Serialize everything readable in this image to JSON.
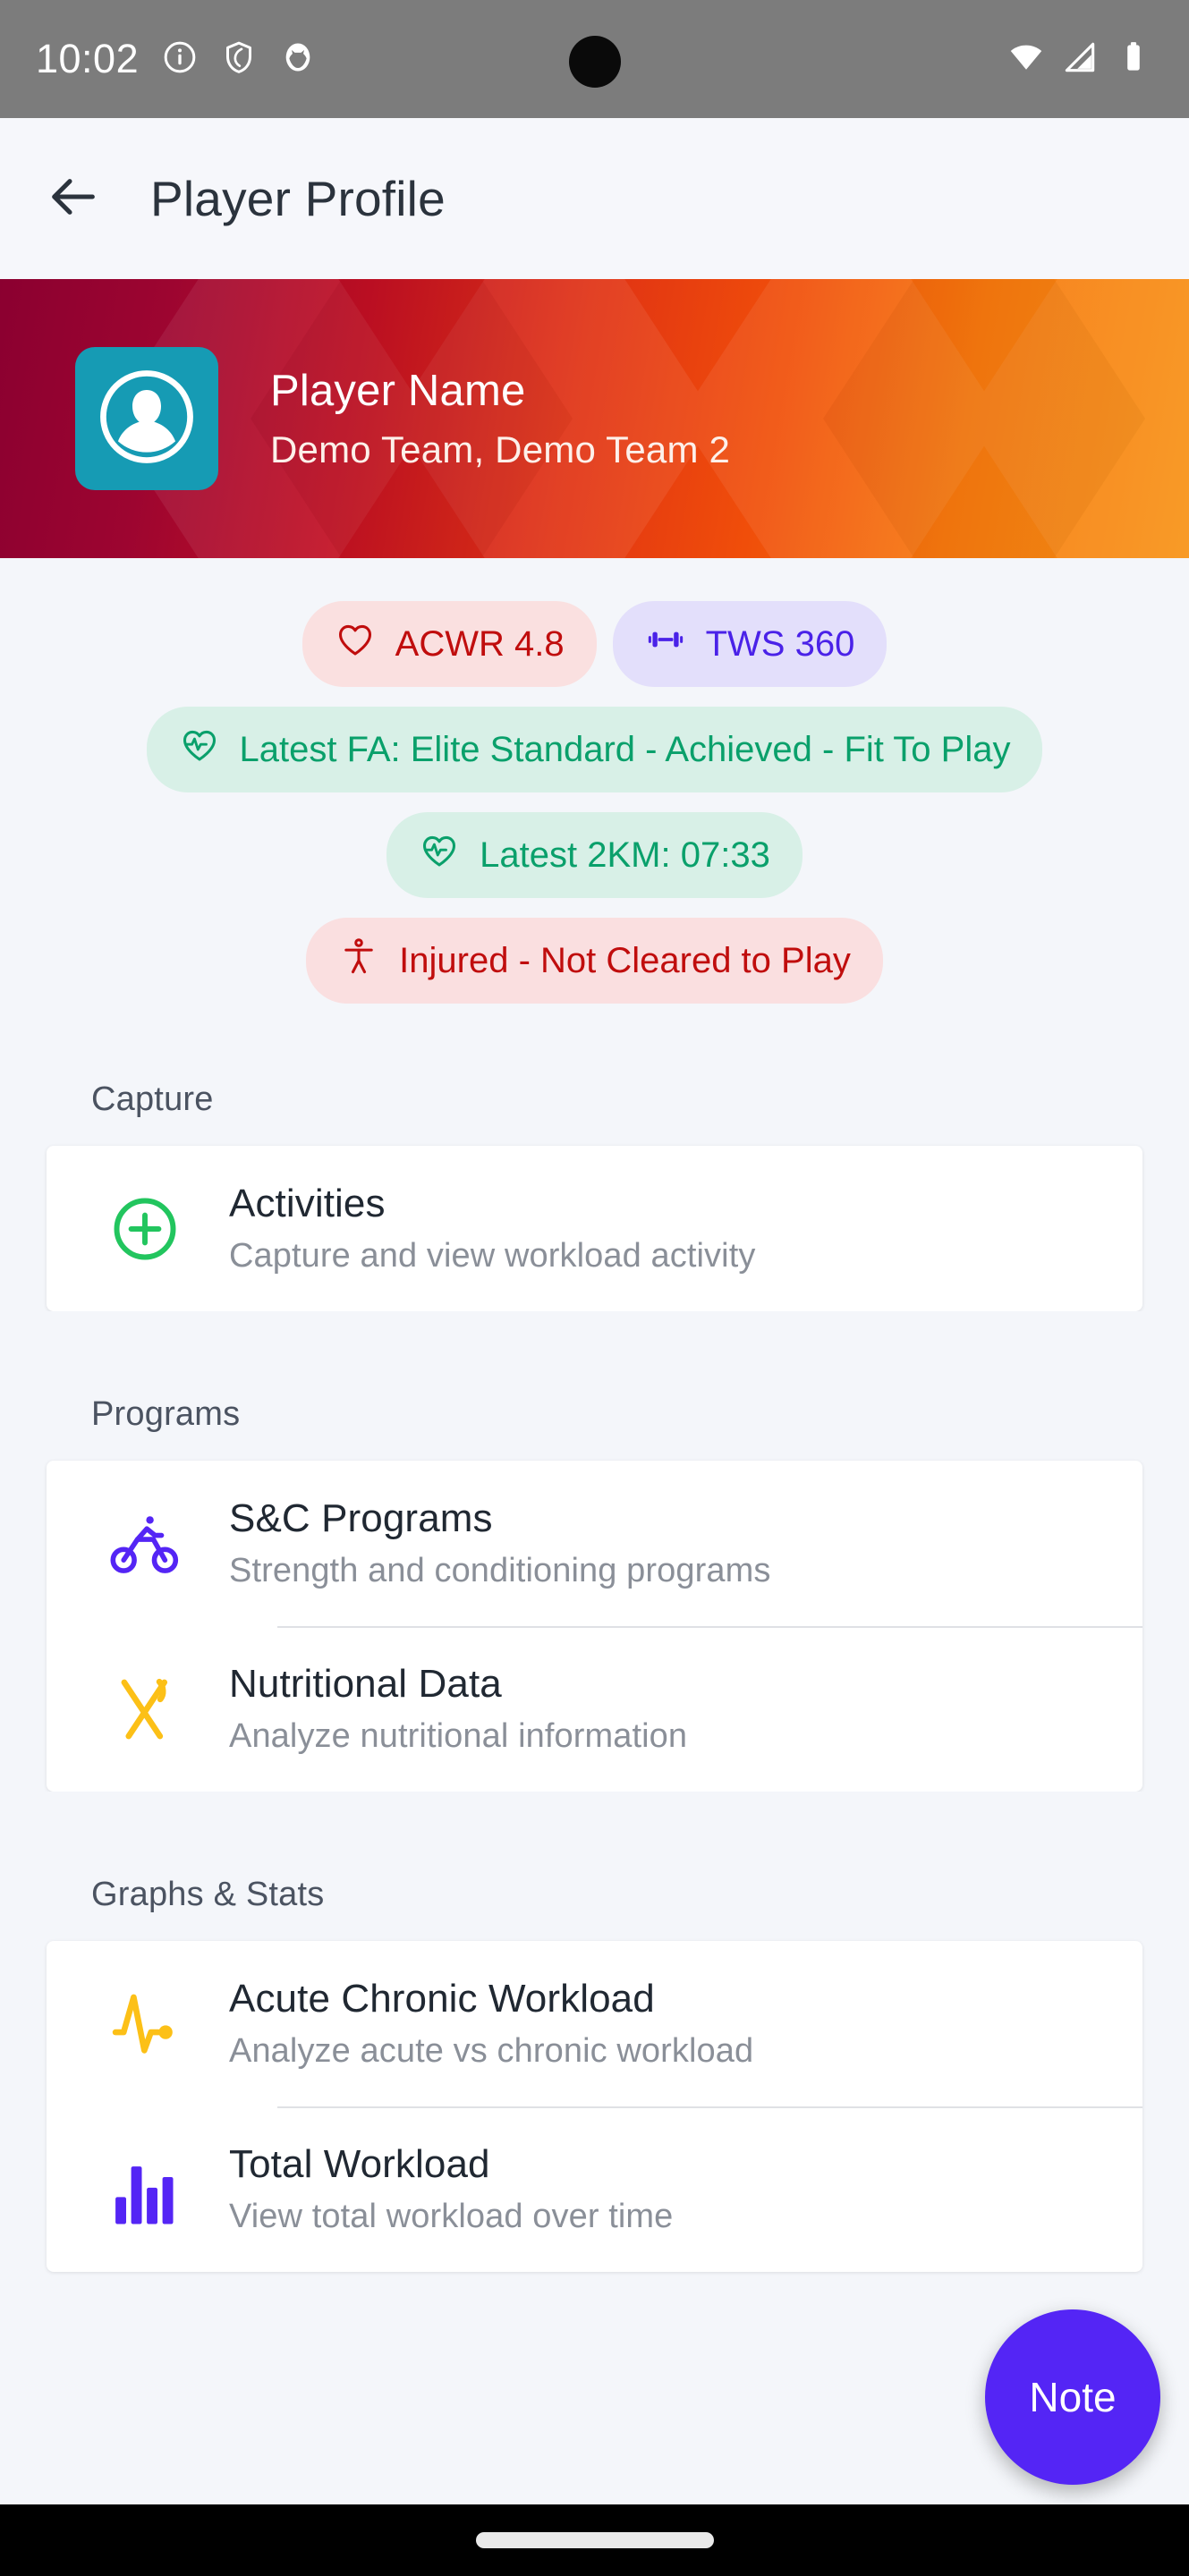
{
  "status_bar": {
    "time": "10:02",
    "left_icons": [
      "info-icon",
      "shield-icon",
      "app-badge-icon"
    ],
    "right_icons": [
      "wifi-icon",
      "cellular-signal-icon",
      "battery-icon"
    ]
  },
  "app_bar": {
    "back_icon": "back-arrow-icon",
    "title": "Player Profile"
  },
  "hero": {
    "avatar_icon": "person-avatar-icon",
    "player_name": "Player Name",
    "teams": "Demo Team, Demo Team 2",
    "gradient_start": "#8b0030",
    "gradient_end": "#f79316",
    "avatar_bg": "#169bb4"
  },
  "chips": [
    {
      "id": "acwr",
      "icon": "heart-outline-icon",
      "label": "ACWR 4.8",
      "text_color": "#c00d0d",
      "bg_color": "#fae0e0"
    },
    {
      "id": "tws",
      "icon": "dumbbell-icon",
      "label": "TWS 360",
      "text_color": "#4a22e8",
      "bg_color": "#e3dffb"
    },
    {
      "id": "fa",
      "icon": "heart-pulse-icon",
      "label": "Latest FA: Elite Standard - Achieved - Fit To Play",
      "text_color": "#0aa06b",
      "bg_color": "#d8f0e7"
    },
    {
      "id": "2km",
      "icon": "heart-pulse-icon",
      "label": "Latest 2KM: 07:33",
      "text_color": "#0aa06b",
      "bg_color": "#d8f0e7"
    },
    {
      "id": "injured",
      "icon": "accessibility-body-icon",
      "label": "Injured - Not Cleared to Play",
      "text_color": "#c00d0d",
      "bg_color": "#fadfe0"
    }
  ],
  "sections": [
    {
      "title": "Capture",
      "rows": [
        {
          "icon": "plus-circle-icon",
          "icon_color": "#22c55e",
          "title": "Activities",
          "subtitle": "Capture and view workload activity"
        }
      ]
    },
    {
      "title": "Programs",
      "rows": [
        {
          "icon": "cyclist-icon",
          "icon_color": "#5425f5",
          "title": "S&C Programs",
          "subtitle": "Strength and conditioning programs"
        },
        {
          "icon": "fork-knife-icon",
          "icon_color": "#fcc017",
          "title": "Nutritional Data",
          "subtitle": "Analyze nutritional information"
        }
      ]
    },
    {
      "title": "Graphs & Stats",
      "rows": [
        {
          "icon": "pulse-monitor-icon",
          "icon_color": "#fcc017",
          "title": "Acute Chronic Workload",
          "subtitle": "Analyze acute vs chronic workload"
        },
        {
          "icon": "bar-chart-icon",
          "icon_color": "#5425f5",
          "title": "Total Workload",
          "subtitle": "View total workload over time"
        }
      ]
    }
  ],
  "fab": {
    "label": "Note",
    "color": "#5425f5"
  }
}
